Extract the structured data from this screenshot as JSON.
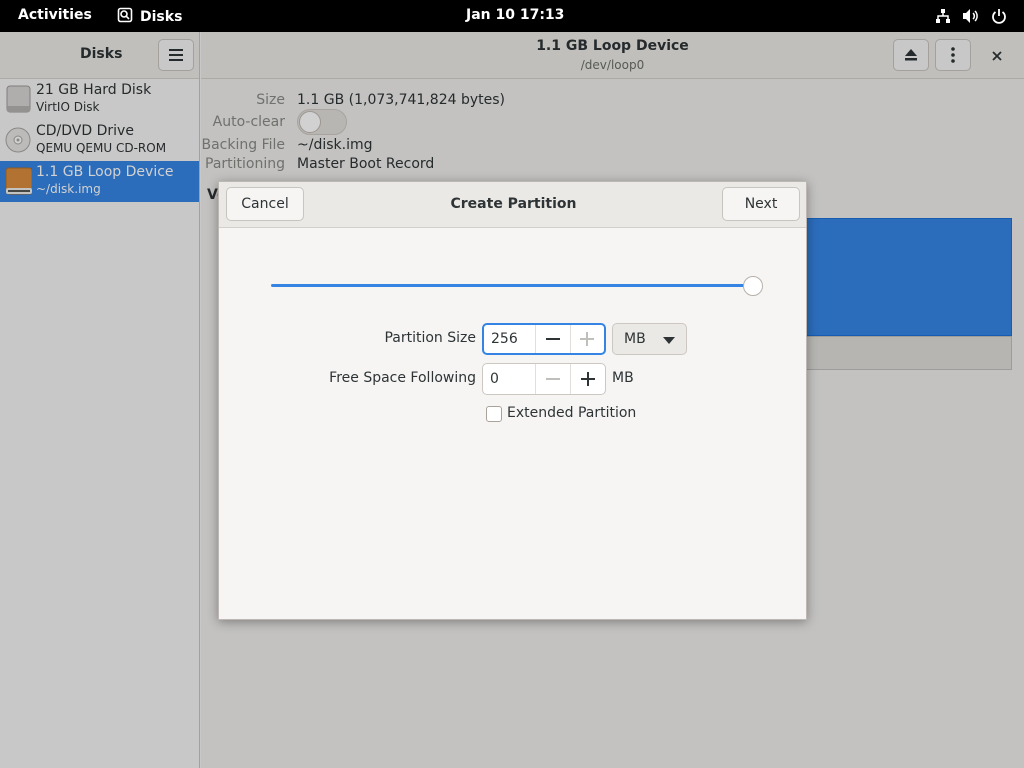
{
  "topbar": {
    "activities": "Activities",
    "app_name": "Disks",
    "clock": "Jan 10  17:13",
    "tray_icons": [
      "network-icon",
      "volume-icon",
      "power-icon"
    ]
  },
  "sidebar": {
    "title": "Disks",
    "disks": [
      {
        "name": "21 GB Hard Disk",
        "sub": "VirtIO Disk",
        "icon": "hard-disk-icon"
      },
      {
        "name": "CD/DVD Drive",
        "sub": "QEMU QEMU CD-ROM",
        "icon": "optical-drive-icon"
      },
      {
        "name": "1.1 GB Loop Device",
        "sub": "~/disk.img",
        "icon": "loop-device-icon"
      }
    ]
  },
  "main": {
    "title": "1.1 GB Loop Device",
    "subtitle": "/dev/loop0",
    "properties": [
      {
        "label": "Size",
        "value": "1.1 GB (1,073,741,824 bytes)"
      },
      {
        "label": "Auto-clear",
        "value": ""
      },
      {
        "label": "Backing File",
        "value": "~/disk.img"
      },
      {
        "label": "Partitioning",
        "value": "Master Boot Record"
      }
    ],
    "volumes_label_fragment": "Vo"
  },
  "dialog": {
    "title": "Create Partition",
    "cancel_label": "Cancel",
    "next_label": "Next",
    "slider_fraction": 1.0,
    "partition_size_label": "Partition Size",
    "partition_size_value": "256",
    "unit": "MB",
    "free_space_label": "Free Space Following",
    "free_space_value": "0",
    "free_space_unit": "MB",
    "extended_label": "Extended Partition"
  },
  "colors": {
    "accent": "#3584e4",
    "loop_device_icon": "#d98c3c"
  }
}
